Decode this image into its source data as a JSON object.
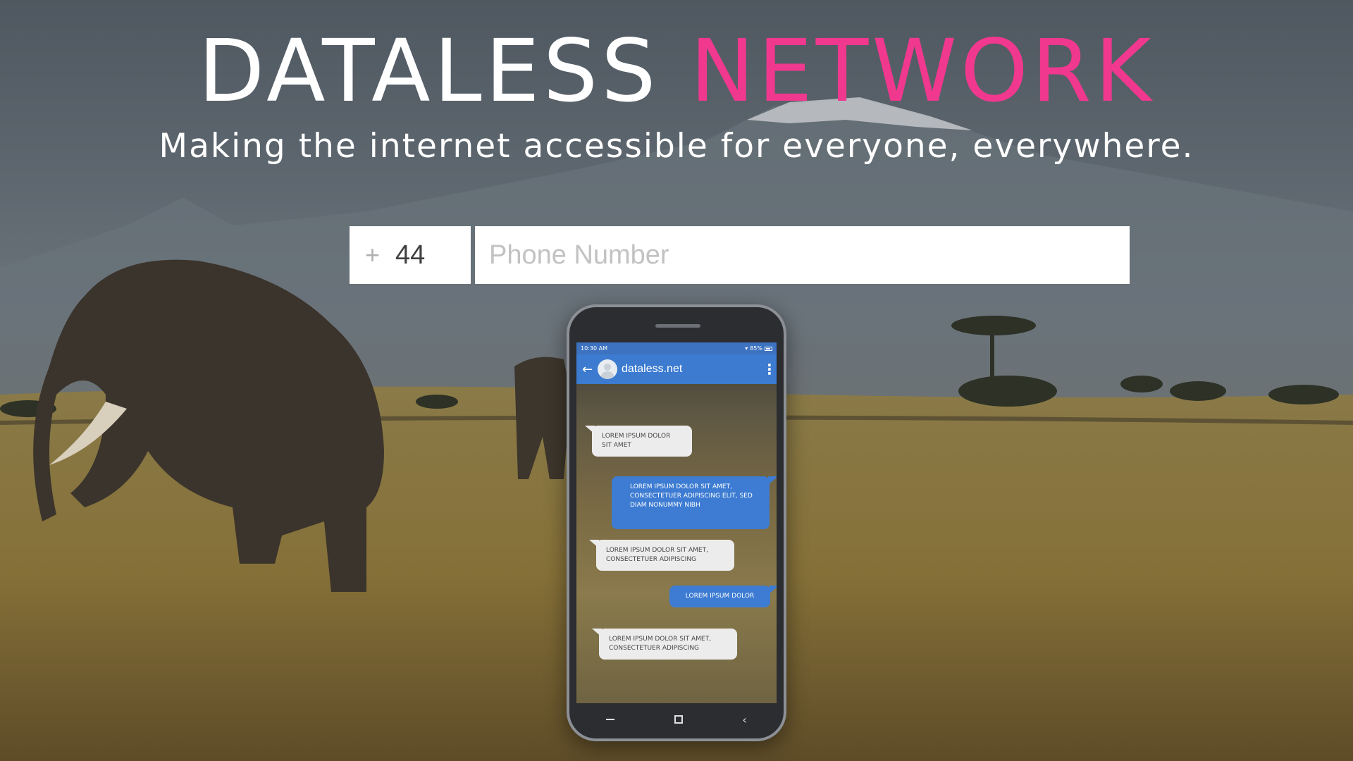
{
  "hero": {
    "title_main": "DATALESS",
    "title_accent": "NETWORK",
    "subtitle": "Making the internet accessible for everyone, everywhere.",
    "accent_color": "#f0388f"
  },
  "form": {
    "country_prefix": "+",
    "country_code": "44",
    "phone_placeholder": "Phone Number"
  },
  "device": {
    "status_time": "10:30 AM",
    "status_battery": "85%",
    "contact_name": "dataless.net",
    "icons": {
      "back": "back-arrow-icon",
      "more": "more-vertical-icon",
      "wifi": "wifi-icon",
      "battery": "battery-icon"
    },
    "messages": [
      {
        "direction": "incoming",
        "text": "LOREM IPSUM DOLOR SIT AMET"
      },
      {
        "direction": "outgoing",
        "text": "LOREM IPSUM DOLOR SIT AMET, CONSECTETUER ADIPISCING ELIT, SED DIAM NONUMMY NIBH"
      },
      {
        "direction": "incoming",
        "text": "LOREM IPSUM DOLOR SIT AMET, CONSECTETUER ADIPISCING"
      },
      {
        "direction": "outgoing",
        "text": "LOREM IPSUM DOLOR"
      },
      {
        "direction": "incoming",
        "text": "LOREM IPSUM DOLOR SIT AMET, CONSECTETUER ADIPISCING"
      }
    ]
  }
}
